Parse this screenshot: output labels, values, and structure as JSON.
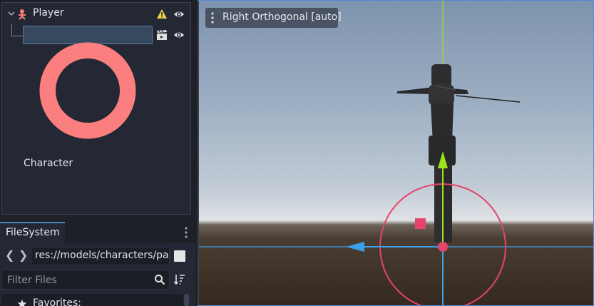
{
  "scene_tree": {
    "root": {
      "label": "Player",
      "icon": "skeleton-icon",
      "warning_icon": "warning-icon",
      "visibility_icon": "eye-icon"
    },
    "child": {
      "label": "Character",
      "icon": "node3d-icon",
      "scene_icon": "clapperboard-icon",
      "visibility_icon": "eye-icon"
    }
  },
  "filesystem": {
    "tab_label": "FileSystem",
    "path_value": "res://models/characters/pal",
    "filter_placeholder": "Filter Files",
    "favorites_label": "Favorites:"
  },
  "viewport": {
    "view_label": "Right Orthogonal [auto]"
  },
  "colors": {
    "accent": "#4b84c2",
    "gizmo_x": "#e5456a",
    "gizmo_y": "#9be41b",
    "gizmo_z": "#3ba0ea",
    "warning": "#f1d44a"
  }
}
